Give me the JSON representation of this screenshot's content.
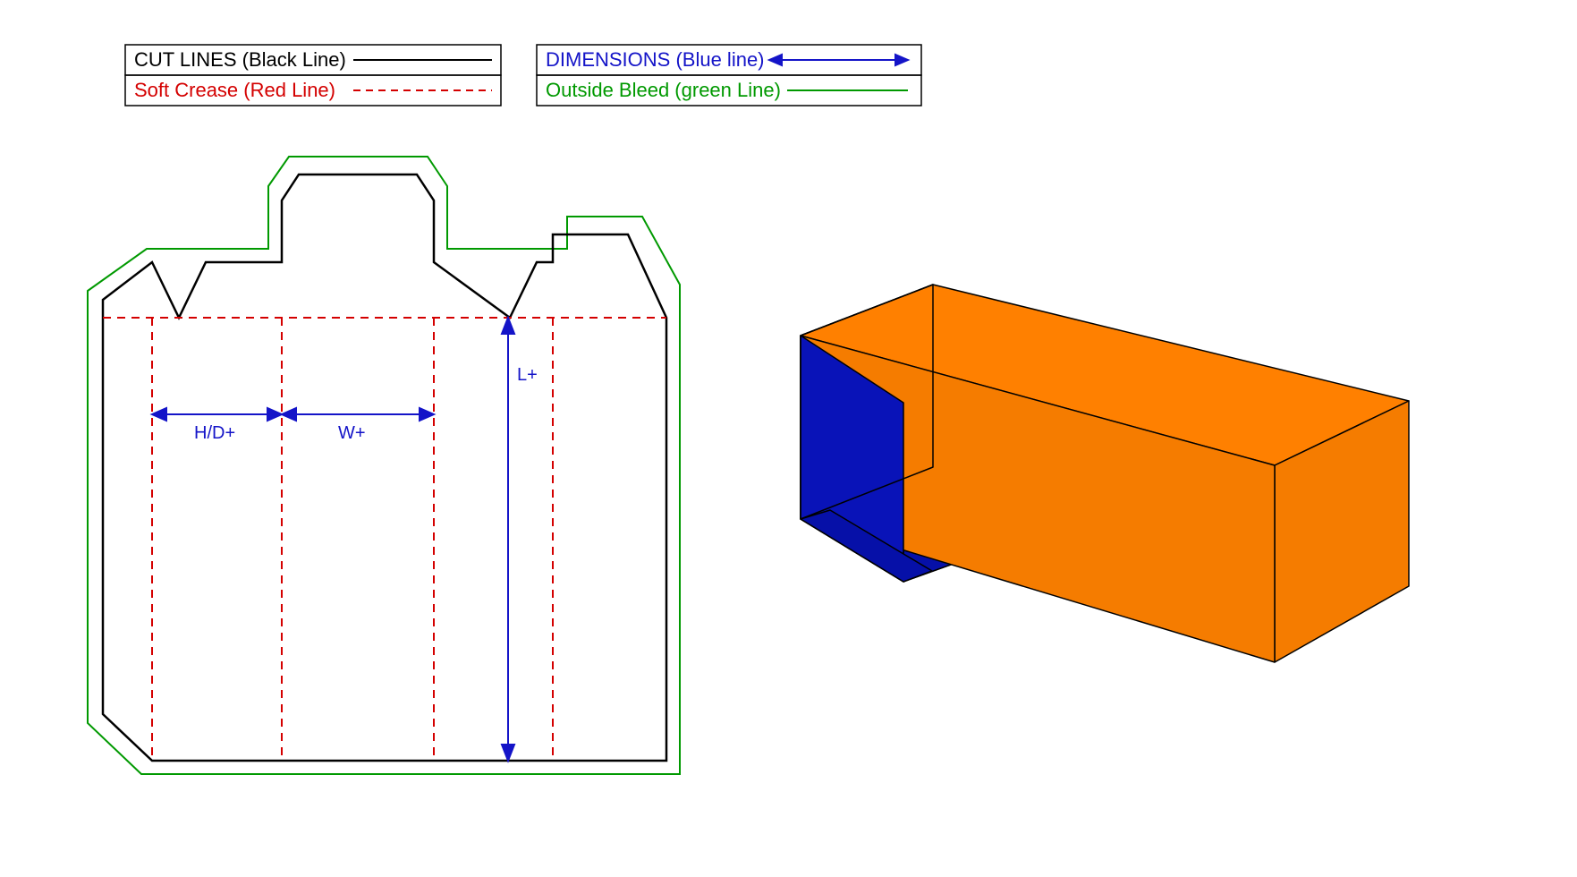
{
  "legend": {
    "cut": {
      "label": "CUT LINES (Black Line)",
      "color": "#000000"
    },
    "crease": {
      "label": "Soft Crease (Red Line)",
      "color": "#d40000"
    },
    "dim": {
      "label": "DIMENSIONS (Blue line)",
      "color": "#1414c8"
    },
    "bleed": {
      "label": "Outside Bleed (green Line)",
      "color": "#009900"
    }
  },
  "dimensions": {
    "hd": "H/D+",
    "w": "W+",
    "l": "L+"
  },
  "colors": {
    "cut": "#000000",
    "crease": "#d40000",
    "dim": "#1414c8",
    "bleed": "#009900",
    "box_outer": "#f57c00",
    "box_outer_top": "#ff8000",
    "box_inner": "#0b16d6",
    "box_inner_dark": "#0610a8"
  }
}
